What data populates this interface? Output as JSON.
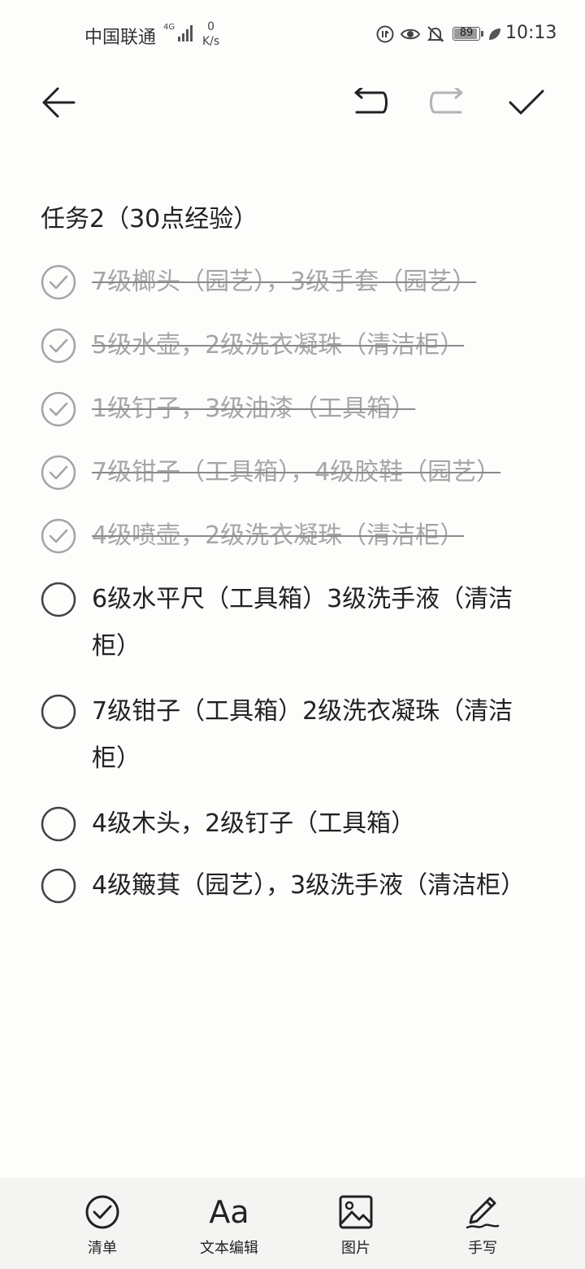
{
  "status_bar": {
    "carrier": "中国联通",
    "network_type": "4G",
    "network_speed_value": "0",
    "network_speed_unit": "K/s",
    "battery_level": "89",
    "time": "10:13"
  },
  "toolbar": {
    "back_icon": "arrow-left-icon",
    "undo_icon": "undo-icon",
    "redo_icon": "redo-icon",
    "confirm_icon": "checkmark-icon"
  },
  "note": {
    "title": "任务2（30点经验）",
    "tasks": [
      {
        "text": "7级榔头（园艺），3级手套（园艺）",
        "done": true
      },
      {
        "text": "5级水壶，2级洗衣凝珠（清洁柜）",
        "done": true
      },
      {
        "text": "1级钉子，3级油漆（工具箱）",
        "done": true
      },
      {
        "text": "7级钳子（工具箱），4级胶鞋（园艺）",
        "done": true
      },
      {
        "text": "4级喷壶，2级洗衣凝珠（清洁柜）",
        "done": true
      },
      {
        "text": "6级水平尺（工具箱）3级洗手液（清洁柜）",
        "done": false
      },
      {
        "text": "7级钳子（工具箱）2级洗衣凝珠（清洁柜）",
        "done": false
      },
      {
        "text": "4级木头，2级钉子（工具箱）",
        "done": false
      },
      {
        "text": "4级簸萁（园艺），3级洗手液（清洁柜）",
        "done": false
      }
    ]
  },
  "bottom_bar": {
    "items": [
      {
        "label": "清单",
        "icon": "checklist-icon"
      },
      {
        "label": "文本编辑",
        "icon": "text-format-icon",
        "glyph": "Aa"
      },
      {
        "label": "图片",
        "icon": "image-icon"
      },
      {
        "label": "手写",
        "icon": "handwriting-icon"
      }
    ]
  },
  "colors": {
    "background": "#fdfdfb",
    "text": "#222222",
    "done_text": "#a6a6a6",
    "bottom_bar": "#f4f4f2"
  }
}
